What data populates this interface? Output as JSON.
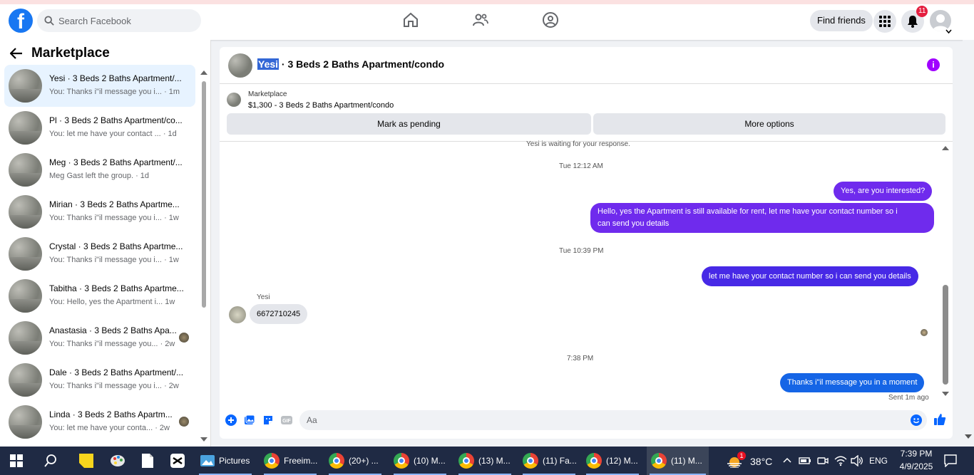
{
  "topnav": {
    "logo_letter": "f",
    "search_placeholder": "Search Facebook",
    "find_friends": "Find friends",
    "notification_count": "11"
  },
  "sidebar": {
    "title": "Marketplace",
    "conversations": [
      {
        "name": "Yesi · 3 Beds 2 Baths Apartment/...",
        "preview": "You: Thanks i\"il message you i...",
        "time": "· 1m",
        "active": true
      },
      {
        "name": "Pl · 3 Beds 2 Baths Apartment/co...",
        "preview": "You: let me have your contact ...",
        "time": "· 1d"
      },
      {
        "name": "Meg · 3 Beds 2 Baths Apartment/...",
        "preview": "Meg Gast left the group.",
        "time": "· 1d"
      },
      {
        "name": "Mirian · 3 Beds 2 Baths Apartme...",
        "preview": "You: Thanks i\"il message you i...",
        "time": "· 1w"
      },
      {
        "name": "Crystal · 3 Beds 2 Baths Apartme...",
        "preview": "You: Thanks i\"il message you i...",
        "time": "· 1w"
      },
      {
        "name": "Tabitha · 3 Beds 2 Baths Apartme...",
        "preview": "You: Hello, yes the Apartment i...",
        "time": "1w"
      },
      {
        "name": "Anastasia · 3 Beds 2 Baths Apa...",
        "preview": "You: Thanks i\"il message you...",
        "time": "· 2w"
      },
      {
        "name": "Dale · 3 Beds 2 Baths Apartment/...",
        "preview": "You: Thanks i\"il message you i...",
        "time": "· 2w"
      },
      {
        "name": "Linda · 3 Beds 2 Baths Apartm...",
        "preview": "You: let me have your conta...",
        "time": "· 2w"
      }
    ]
  },
  "chat": {
    "title_highlight": "Yesi",
    "title_rest": " · 3 Beds 2 Baths Apartment/condo",
    "marketplace_label": "Marketplace",
    "listing": "$1,300 - 3 Beds 2 Baths Apartment/condo",
    "mark_pending": "Mark as pending",
    "more_options": "More options",
    "waiting": "Yesi is waiting for your response.",
    "time1": "Tue 12:12 AM",
    "msg1": "Yes, are you interested?",
    "msg2_line1": "Hello, yes the Apartment is still available for rent, let me have your contact number so i",
    "msg2_line2": "can send you details",
    "time2": "Tue 10:39 PM",
    "msg3": "let me have your contact number so i can send you details",
    "incoming_name": "Yesi",
    "incoming_msg": "6672710245",
    "time3": "7:38 PM",
    "msg4": "Thanks i\"il message you in a moment",
    "sent_status": "Sent 1m ago",
    "composer_placeholder": "Aa"
  },
  "taskbar": {
    "pictures": "Pictures",
    "tabs": [
      "Freeim...",
      "(20+) ...",
      "(10) M...",
      "(13) M...",
      "(11) Fa...",
      "(12) M...",
      "(11) M..."
    ],
    "weather_badge": "1",
    "temperature": "38°C",
    "language": "ENG",
    "time": "7:39 PM",
    "date": "4/9/2025"
  }
}
